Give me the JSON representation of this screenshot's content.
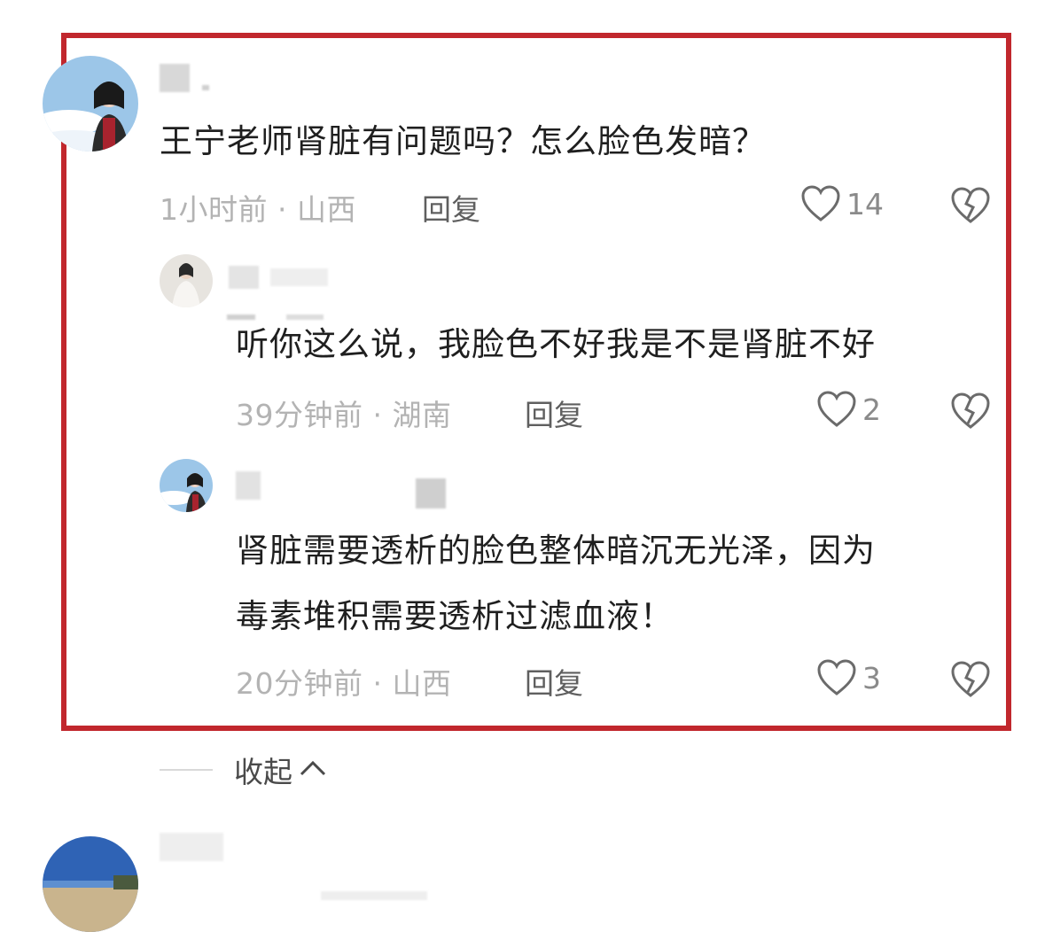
{
  "comments": [
    {
      "text": "王宁老师肾脏有问题吗？怎么脸色发暗？",
      "meta": "1小时前 · 山西",
      "reply_label": "回复",
      "like_count": "14"
    }
  ],
  "replies": [
    {
      "text": "听你这么说，我脸色不好我是不是肾脏不好",
      "meta": "39分钟前 · 湖南",
      "reply_label": "回复",
      "like_count": "2"
    },
    {
      "text_line1": "肾脏需要透析的脸色整体暗沉无光泽，因为",
      "text_line2": "毒素堆积需要透析过滤血液！",
      "meta": "20分钟前 · 山西",
      "reply_label": "回复",
      "like_count": "3"
    }
  ],
  "collapse": {
    "label": "收起",
    "icon": "chevron-up-icon"
  },
  "colors": {
    "highlight_border": "#c1272d",
    "meta_text": "#b3b3b3"
  },
  "icons": {
    "like": "heart-outline-icon",
    "dislike": "broken-heart-icon"
  }
}
